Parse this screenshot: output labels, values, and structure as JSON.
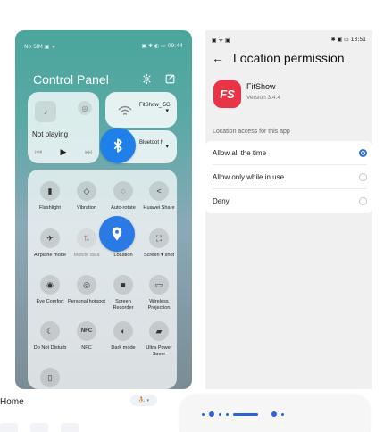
{
  "left_panel": {
    "status_left": "No SIM ▣ ᯤ",
    "status_right": "▣ ✱ ◐ ▭ 09:44",
    "title": "Control Panel",
    "settings_icon": "gear-icon",
    "edit_icon": "edit-icon",
    "media": {
      "status": "Not playing",
      "prev": "⏮",
      "play": "▶",
      "next": "⏭",
      "music_icon": "music-note-icon",
      "device_icon": "cast-icon"
    },
    "wifi": {
      "name": "FitShow_ 5G",
      "caret": "▾"
    },
    "bluetooth": {
      "name": "Bluetoot h",
      "caret": "▾"
    },
    "tiles": [
      {
        "label": "Flashlight",
        "icon": "flashlight-icon",
        "glyph": "▮"
      },
      {
        "label": "Vibration",
        "icon": "vibration-icon",
        "glyph": "◇"
      },
      {
        "label": "Auto-rotate",
        "icon": "rotate-icon",
        "glyph": "◌"
      },
      {
        "label": "Huawei Share",
        "icon": "share-icon",
        "glyph": "<"
      },
      {
        "label": "Airplane mode",
        "icon": "airplane-icon",
        "glyph": "✈"
      },
      {
        "label": "Mobile data",
        "icon": "mobile-data-icon",
        "glyph": "⇅"
      },
      {
        "label": "Location",
        "icon": "location-icon",
        "glyph": "⌖"
      },
      {
        "label": "Screen ▾ shot",
        "icon": "screenshot-icon",
        "glyph": "⛶"
      },
      {
        "label": "Eye Comfort",
        "icon": "eye-icon",
        "glyph": "◉"
      },
      {
        "label": "Personal hotspot",
        "icon": "hotspot-icon",
        "glyph": "◎"
      },
      {
        "label": "Screen Recorder",
        "icon": "recorder-icon",
        "glyph": "■"
      },
      {
        "label": "Wireless Projection",
        "icon": "projection-icon",
        "glyph": "▭"
      },
      {
        "label": "Do Not Disturb",
        "icon": "moon-icon",
        "glyph": "☾"
      },
      {
        "label": "NFC",
        "icon": "nfc-icon",
        "glyph": "NFC"
      },
      {
        "label": "Dark mode",
        "icon": "dark-mode-icon",
        "glyph": "◐"
      },
      {
        "label": "Ultra Power Saver",
        "icon": "power-saver-icon",
        "glyph": "▰"
      },
      {
        "label": "",
        "icon": "battery-icon",
        "glyph": "▯"
      }
    ]
  },
  "right_panel": {
    "status_left": "▣ ᯤ ▣",
    "status_right": "✱ ▣ ▭ 13:51",
    "back": "←",
    "title": "Location permission",
    "app": {
      "logo_text": "FS",
      "name": "FitShow",
      "version": "Version 3.4.4"
    },
    "section_label": "Location access for this app",
    "options": [
      {
        "label": "Allow all the time",
        "selected": true
      },
      {
        "label": "Allow only while in use",
        "selected": false
      },
      {
        "label": "Deny",
        "selected": false
      }
    ]
  },
  "bottom": {
    "home_label": "Home",
    "home_pill_icon": "person-walk-icon",
    "home_pill_glyph": "⛹",
    "home_pill_arrow": "▾"
  },
  "colors": {
    "accent_blue": "#1e80e8",
    "fitshow_red": "#ea3344",
    "radio_blue": "#2a6ce0",
    "control_panel_teal": "#4aa69c"
  }
}
